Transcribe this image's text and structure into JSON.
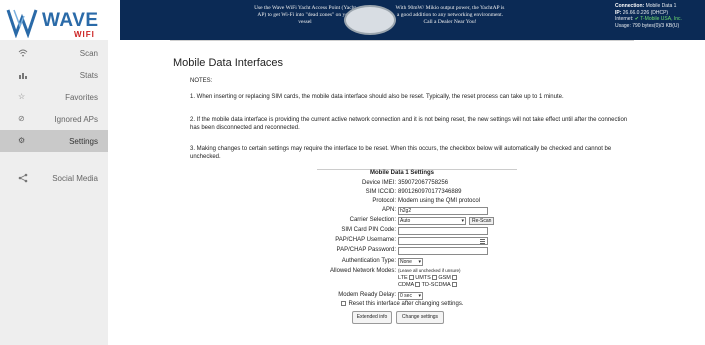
{
  "header": {
    "logo_text": "WAVE",
    "logo_sub": "WIFI",
    "ad_left": "Use the Wave WiFi Yacht Access Point (Yacht AP) to get Wi-Fi into \"dead zones\" on your vessel",
    "ad_right": "With 90mW/ Mikio output power, the YachtAP is a good addition to any networking environment. Call a Dealer Near You!",
    "status": {
      "connection_label": "Connection:",
      "connection_value": "Mobile Data 1",
      "ip_label": "IP:",
      "ip_value": "26.66.0.226 (DHCP)",
      "internet_label": "Internet:",
      "internet_value": "✔ T-Mobile USA, Inc.",
      "usage_label": "Usage:",
      "usage_value": "790 bytes(0)/3 KB(U)"
    },
    "accent_color": "#0b2a55"
  },
  "sidebar": {
    "items": [
      {
        "label": "Scan",
        "icon": "wifi-icon"
      },
      {
        "label": "Stats",
        "icon": "bar-chart-icon"
      },
      {
        "label": "Favorites",
        "icon": "star-icon"
      },
      {
        "label": "Ignored APs",
        "icon": "blocked-icon"
      },
      {
        "label": "Settings",
        "icon": "gear-icon",
        "active": true
      },
      {
        "label": "Social Media",
        "icon": "share-icon"
      }
    ]
  },
  "main": {
    "title": "Mobile Data Interfaces",
    "notes_title": "NOTES:",
    "notes": [
      "1. When inserting or replacing SIM cards, the mobile data interface should also be reset. Typically, the reset process can take up to 1 minute.",
      "2. If the mobile data interface is providing the current active network connection and it is not being reset, the new settings will not take effect until after the connection has been disconnected and reconnected.",
      "3. Making changes to certain settings may require the interface to be reset. When this occurs, the checkbox below will automatically be checked and cannot be unchecked."
    ],
    "settings_title": "Mobile Data 1 Settings",
    "device_imei_label": "Device IMEI:",
    "device_imei": "359072067758256",
    "sim_iccid_label": "SIM ICCID:",
    "sim_iccid": "8901260970177346889",
    "protocol_label": "Protocol:",
    "protocol": "Modem using the QMI protocol",
    "apn_label": "APN:",
    "apn": "h2g2",
    "carrier_label": "Carrier Selection:",
    "carrier": "Auto",
    "rescan": "Re-Scan",
    "sim_pin_label": "SIM Card PIN Code:",
    "pap_user_label": "PAP/CHAP Username:",
    "pap_pass_label": "PAP/CHAP Password:",
    "auth_label": "Authentication Type:",
    "auth": "None",
    "modes_label": "Allowed Network Modes:",
    "modes_hint": "(Leave all unchecked if unsure)",
    "mode_lte": "LTE",
    "mode_umts": "UMTS",
    "mode_gsm": "GSM",
    "mode_cdma": "CDMA",
    "mode_tdscdma": "TD-SCDMA",
    "delay_label": "Modem Ready Delay:",
    "delay": "0 sec",
    "reset_label": "Reset this interface after changing settings.",
    "extended_btn": "Extended info",
    "change_btn": "Change settings"
  }
}
